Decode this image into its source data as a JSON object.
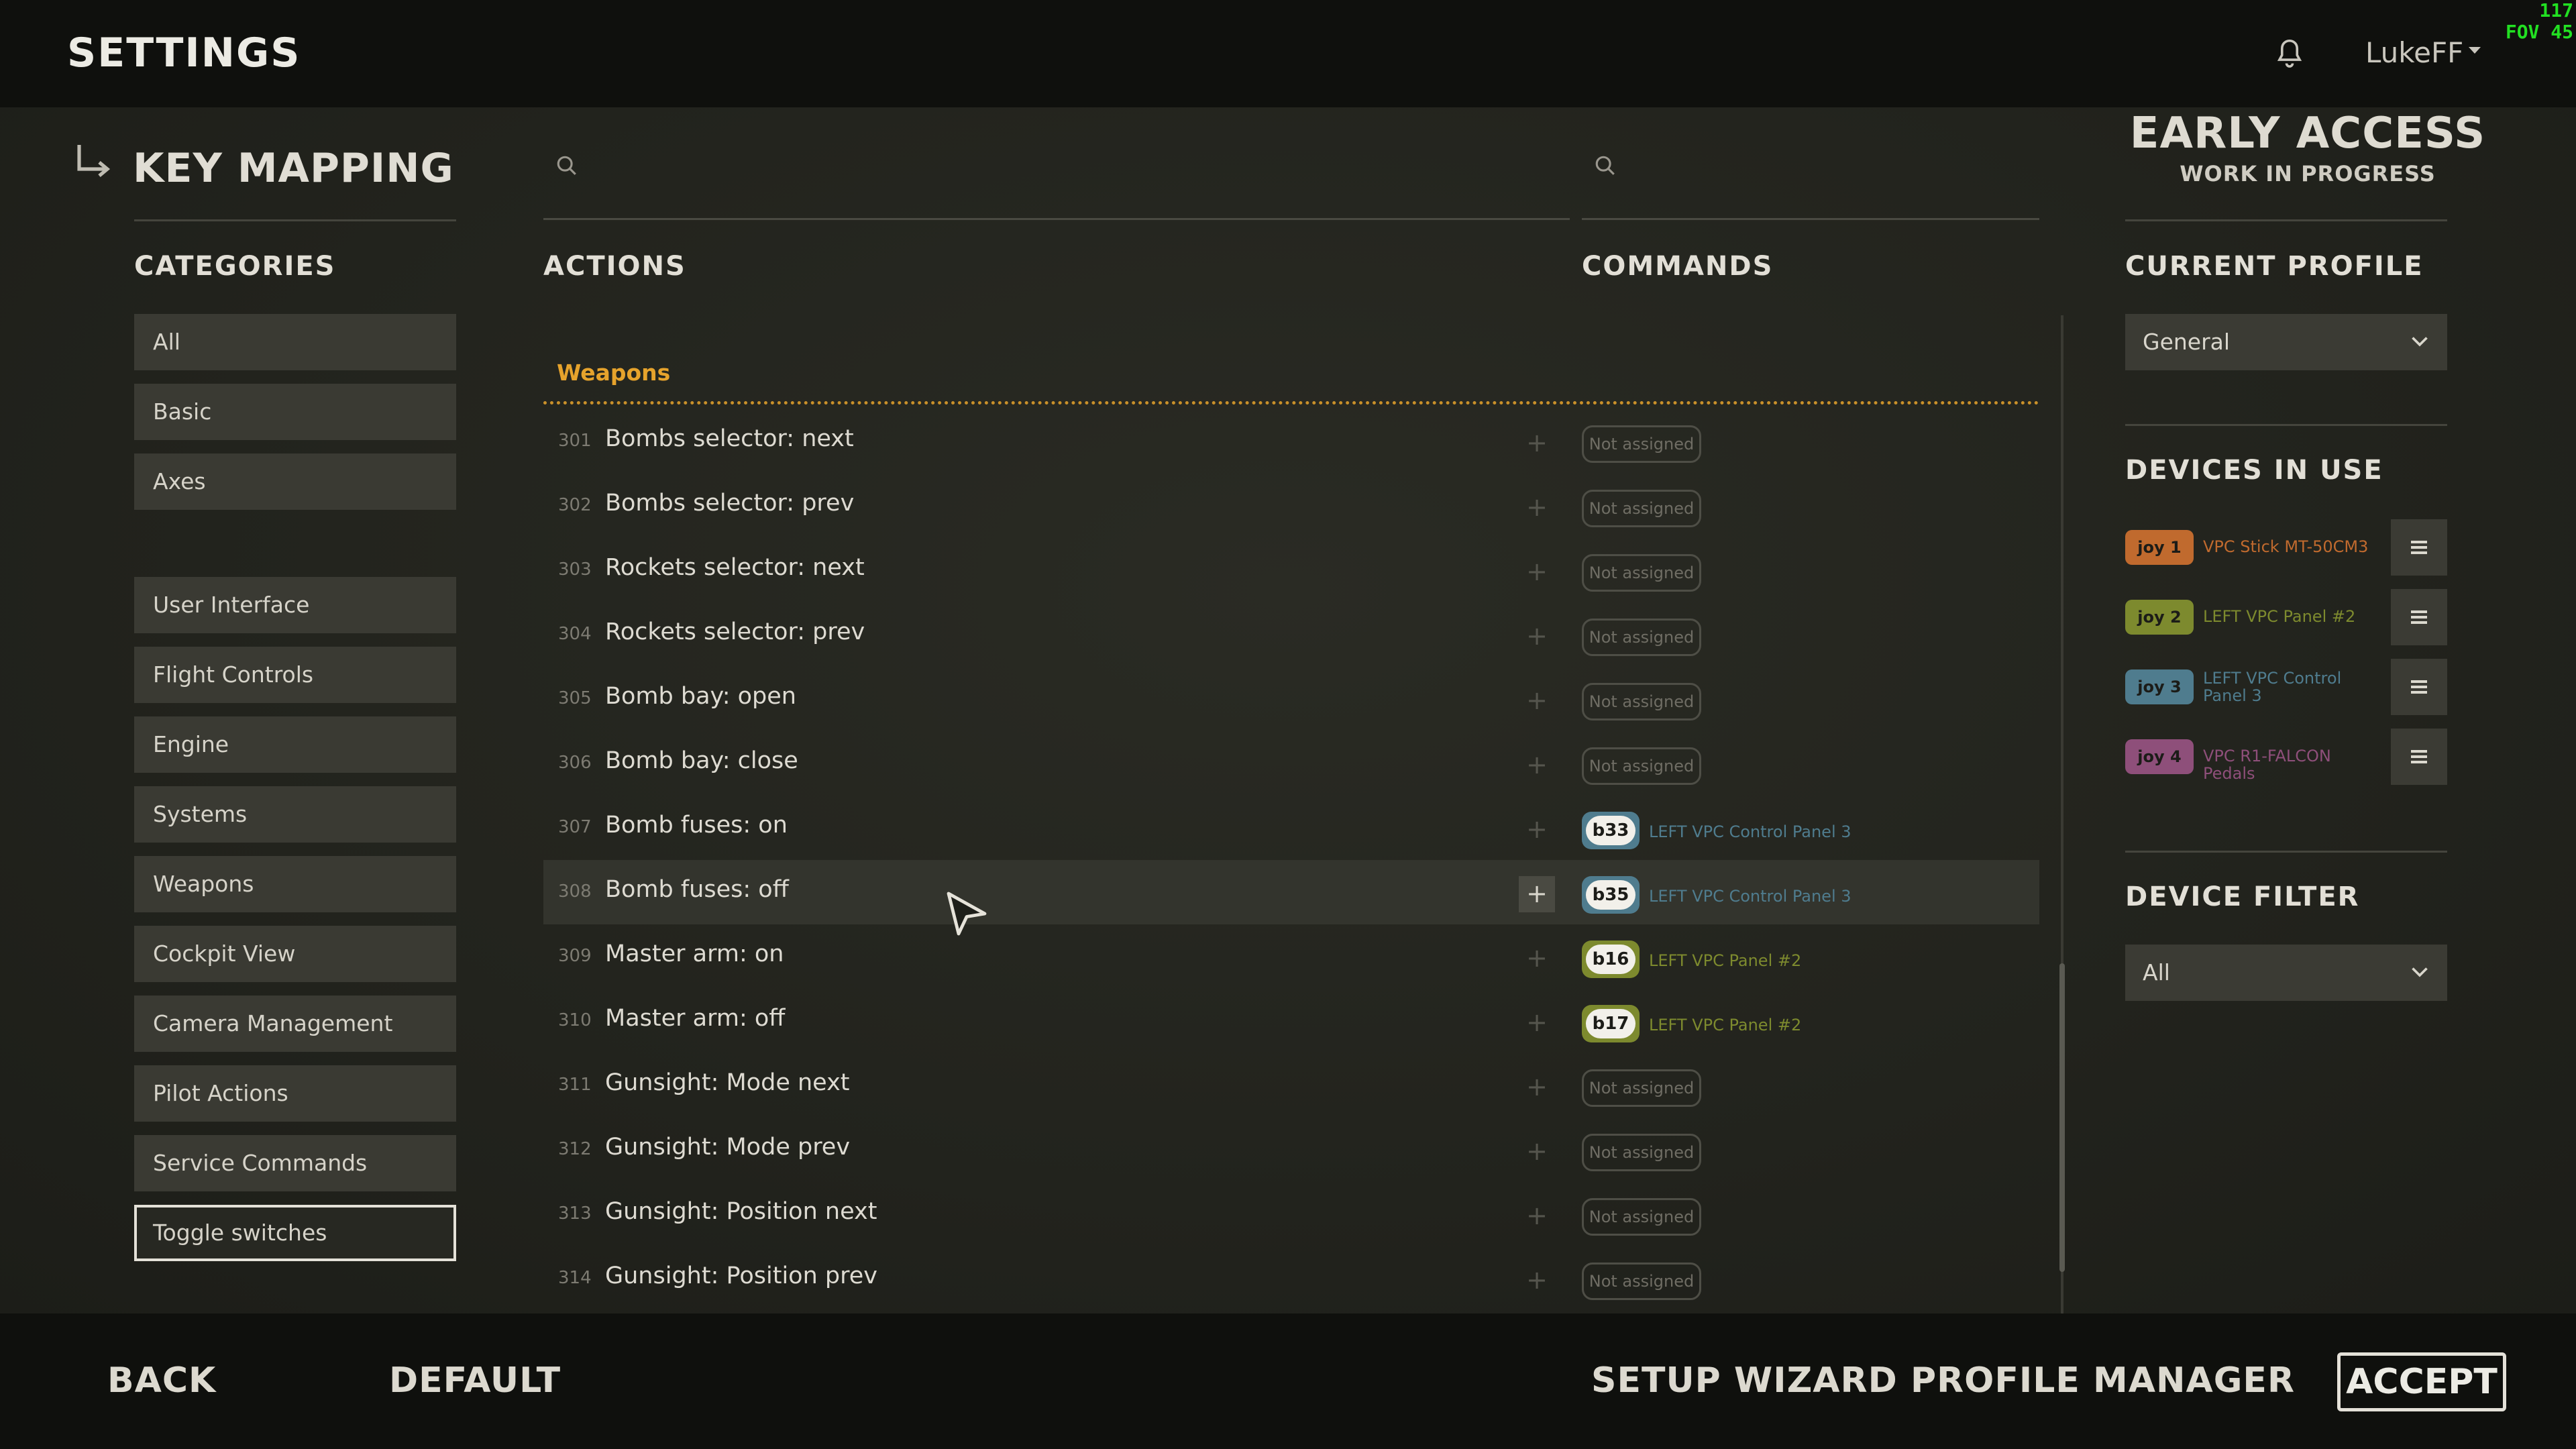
{
  "header": {
    "title": "SETTINGS",
    "username": "LukeFF",
    "debug_line1": "117",
    "debug_line2": "FOV 45"
  },
  "page": {
    "title": "KEY MAPPING",
    "early_access": "EARLY ACCESS",
    "work_in_progress": "WORK IN PROGRESS"
  },
  "search_actions": {
    "placeholder": ""
  },
  "search_commands": {
    "placeholder": ""
  },
  "headings": {
    "categories": "CATEGORIES",
    "actions": "ACTIONS",
    "commands": "COMMANDS",
    "current_profile": "CURRENT PROFILE",
    "devices_in_use": "DEVICES IN USE",
    "device_filter": "DEVICE FILTER"
  },
  "categories": [
    {
      "label": "All"
    },
    {
      "label": "Basic"
    },
    {
      "label": "Axes"
    },
    {
      "label": "User Interface"
    },
    {
      "label": "Flight Controls"
    },
    {
      "label": "Engine"
    },
    {
      "label": "Systems"
    },
    {
      "label": "Weapons"
    },
    {
      "label": "Cockpit View"
    },
    {
      "label": "Camera Management"
    },
    {
      "label": "Pilot Actions"
    },
    {
      "label": "Service Commands"
    },
    {
      "label": "Toggle switches",
      "selected": true
    }
  ],
  "group_label": "Weapons",
  "not_assigned": "Not assigned",
  "actions": [
    {
      "num": "301",
      "label": "Bombs selector: next"
    },
    {
      "num": "302",
      "label": "Bombs selector: prev"
    },
    {
      "num": "303",
      "label": "Rockets selector: next"
    },
    {
      "num": "304",
      "label": "Rockets selector: prev"
    },
    {
      "num": "305",
      "label": "Bomb bay: open"
    },
    {
      "num": "306",
      "label": "Bomb bay: close"
    },
    {
      "num": "307",
      "label": "Bomb fuses: on",
      "key": "b33",
      "device": "LEFT VPC Control Panel 3"
    },
    {
      "num": "308",
      "label": "Bomb fuses: off",
      "key": "b35",
      "device": "LEFT VPC Control Panel 3",
      "hover": true
    },
    {
      "num": "309",
      "label": "Master arm: on",
      "key": "b16",
      "device": "LEFT VPC Panel #2"
    },
    {
      "num": "310",
      "label": "Master arm: off",
      "key": "b17",
      "device": "LEFT VPC Panel #2"
    },
    {
      "num": "311",
      "label": "Gunsight: Mode next"
    },
    {
      "num": "312",
      "label": "Gunsight: Mode prev"
    },
    {
      "num": "313",
      "label": "Gunsight: Position next"
    },
    {
      "num": "314",
      "label": "Gunsight: Position prev"
    }
  ],
  "current_profile": {
    "value": "General"
  },
  "devices": [
    {
      "badge": "joy 1",
      "name": "VPC Stick MT-50CM3",
      "color": "#c06a2e"
    },
    {
      "badge": "joy 2",
      "name": "LEFT VPC Panel #2",
      "color": "#7d8a2e"
    },
    {
      "badge": "joy 3",
      "name": "LEFT VPC Control Panel 3",
      "color": "#4f7c8e"
    },
    {
      "badge": "joy 4",
      "name": "VPC R1-FALCON Pedals",
      "color": "#8e4f7a"
    }
  ],
  "device_filter": {
    "value": "All"
  },
  "footer": {
    "back": "BACK",
    "default": "DEFAULT",
    "setup_wizard": "SETUP WIZARD",
    "profile_manager": "PROFILE MANAGER",
    "accept": "ACCEPT"
  },
  "colors": {
    "accent_orange": "#e6a32c",
    "device_panel3": "#4f7c8e",
    "device_panel2": "#7d8a2e"
  }
}
